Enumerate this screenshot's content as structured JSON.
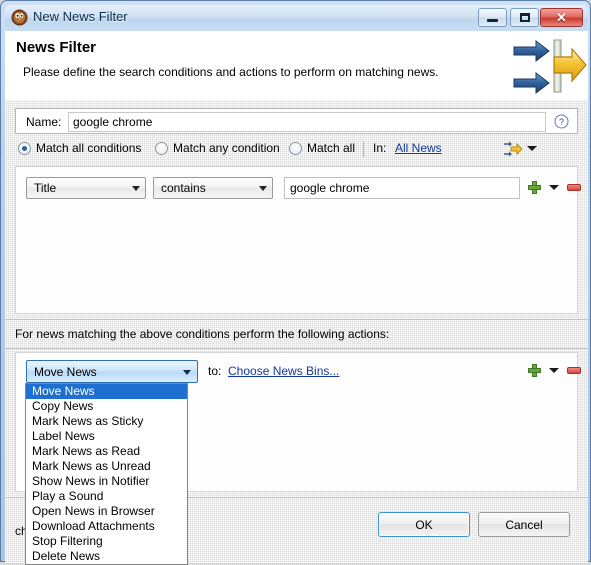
{
  "window": {
    "title": "New News Filter",
    "icon": "rssowl-icon",
    "buttons": {
      "minimize": "minimize-icon",
      "maximize": "maximize-icon",
      "close": "✕"
    }
  },
  "header": {
    "title": "News Filter",
    "subtitle": "Please define the search conditions and actions to perform on matching news.",
    "art_icon": "filter-arrows-icon"
  },
  "name_row": {
    "label": "Name:",
    "value": "google chrome",
    "placeholder": "",
    "help_icon": "help-question-icon"
  },
  "match_row": {
    "options": [
      {
        "label": "Match all conditions",
        "selected": true
      },
      {
        "label": "Match any condition",
        "selected": false
      },
      {
        "label": "Match all",
        "selected": false
      }
    ],
    "in_label": "In:",
    "in_value": "All News",
    "scope_icon": "scope-filter-icon"
  },
  "condition": {
    "field": "Title",
    "operator": "contains",
    "value": "google chrome",
    "placeholder": "",
    "add_icon": "plus-icon",
    "menu_icon": "chevron-down-icon",
    "remove_icon": "minus-icon"
  },
  "actions": {
    "section_label": "For news matching the above conditions perform the following actions:",
    "selected_action": "Move News",
    "to_label": "to:",
    "target_link": "Choose News Bins...",
    "add_icon": "plus-icon",
    "menu_icon": "chevron-down-icon",
    "remove_icon": "minus-icon",
    "dropdown_open": true,
    "dropdown_items": [
      "Move News",
      "Copy News",
      "Mark News as Sticky",
      "Label News",
      "Mark News as Read",
      "Mark News as Unread",
      "Show News in Notifier",
      "Play a Sound",
      "Open News in Browser",
      "Download Attachments",
      "Stop Filtering",
      "Delete News"
    ],
    "dropdown_selected_index": 0
  },
  "footer": {
    "status_text": "ching the conditions.",
    "ok_label": "OK",
    "cancel_label": "Cancel"
  },
  "colors": {
    "accent": "#1f6fd0",
    "link": "#14389e",
    "close_red": "#c83b31",
    "plus_green": "#68a63a",
    "minus_red": "#d64a40"
  }
}
